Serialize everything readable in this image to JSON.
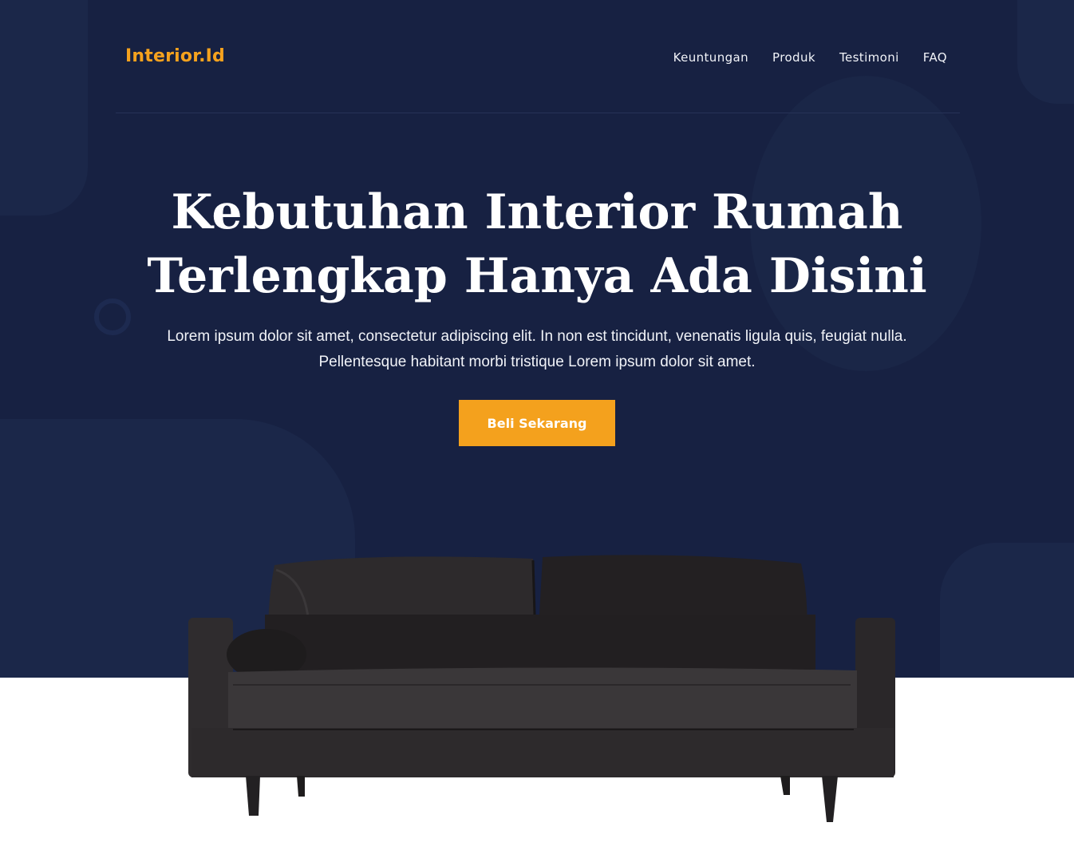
{
  "brand": {
    "logo_text": "Interior.Id",
    "accent_color": "#f5a21e",
    "hero_bg": "#172142"
  },
  "nav": {
    "items": [
      "Keuntungan",
      "Produk",
      "Testimoni",
      "FAQ"
    ]
  },
  "hero": {
    "headline_line1": "Kebutuhan Interior Rumah",
    "headline_line2": "Terlengkap Hanya Ada Disini",
    "sub_line1": "Lorem ipsum dolor sit amet, consectetur adipiscing elit. In non est tincidunt, venenatis ligula quis, feugiat nulla.",
    "sub_line2": "Pellentesque habitant morbi tristique Lorem ipsum dolor sit amet.",
    "cta_label": "Beli Sekarang"
  }
}
